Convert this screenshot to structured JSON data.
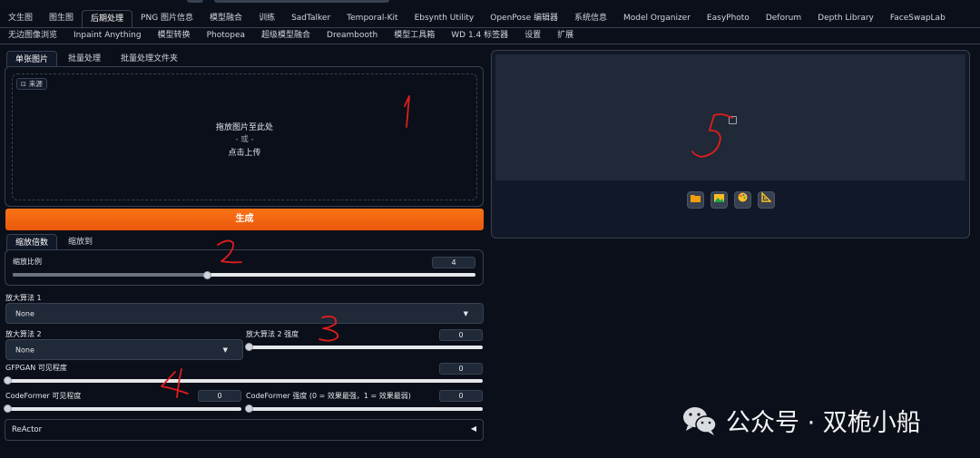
{
  "tabs_row1": [
    "文生图",
    "图生图",
    "后期处理",
    "PNG 图片信息",
    "模型融合",
    "训练",
    "SadTalker",
    "Temporal-Kit",
    "Ebsynth Utility",
    "OpenPose 编辑器",
    "系统信息",
    "Model Organizer",
    "EasyPhoto",
    "Deforum",
    "Depth Library",
    "FaceSwapLab"
  ],
  "tabs_row2": [
    "无边图像浏览",
    "Inpaint Anything",
    "模型转换",
    "Photopea",
    "超级模型融合",
    "Dreambooth",
    "模型工具箱",
    "WD 1.4 标签器",
    "设置",
    "扩展"
  ],
  "active_tab": "后期处理",
  "source_tabs": [
    "单张图片",
    "批量处理",
    "批量处理文件夹"
  ],
  "upload": {
    "badge": "来源",
    "line1": "拖放图片至此处",
    "line2": "- 或 -",
    "line3": "点击上传"
  },
  "generate_label": "生成",
  "scale_tabs": [
    "缩放倍数",
    "缩放到"
  ],
  "scale": {
    "label": "缩放比例",
    "value": "4",
    "fraction": 0.42
  },
  "upscaler1": {
    "label": "放大算法 1",
    "value": "None"
  },
  "upscaler2": {
    "label": "放大算法 2",
    "value": "None"
  },
  "upscaler2_strength": {
    "label": "放大算法 2 强度",
    "value": "0"
  },
  "gfpgan": {
    "label": "GFPGAN 可见程度",
    "value": "0"
  },
  "codeformer_vis": {
    "label": "CodeFormer 可见程度",
    "value": "0"
  },
  "codeformer_weight": {
    "label": "CodeFormer 强度 (0 = 效果最强，1 = 效果最弱)",
    "value": "0"
  },
  "reactor": {
    "label": "ReActor",
    "arrow": "◀"
  },
  "watermark": {
    "text": "公众号 · 双桅小船"
  },
  "annotations": [
    "1",
    "2",
    "3",
    "4",
    "5"
  ],
  "colors": {
    "accent": "#f97316",
    "bg": "#0b0f19",
    "panel": "#1f2937",
    "annotation": "#e11d1d"
  }
}
